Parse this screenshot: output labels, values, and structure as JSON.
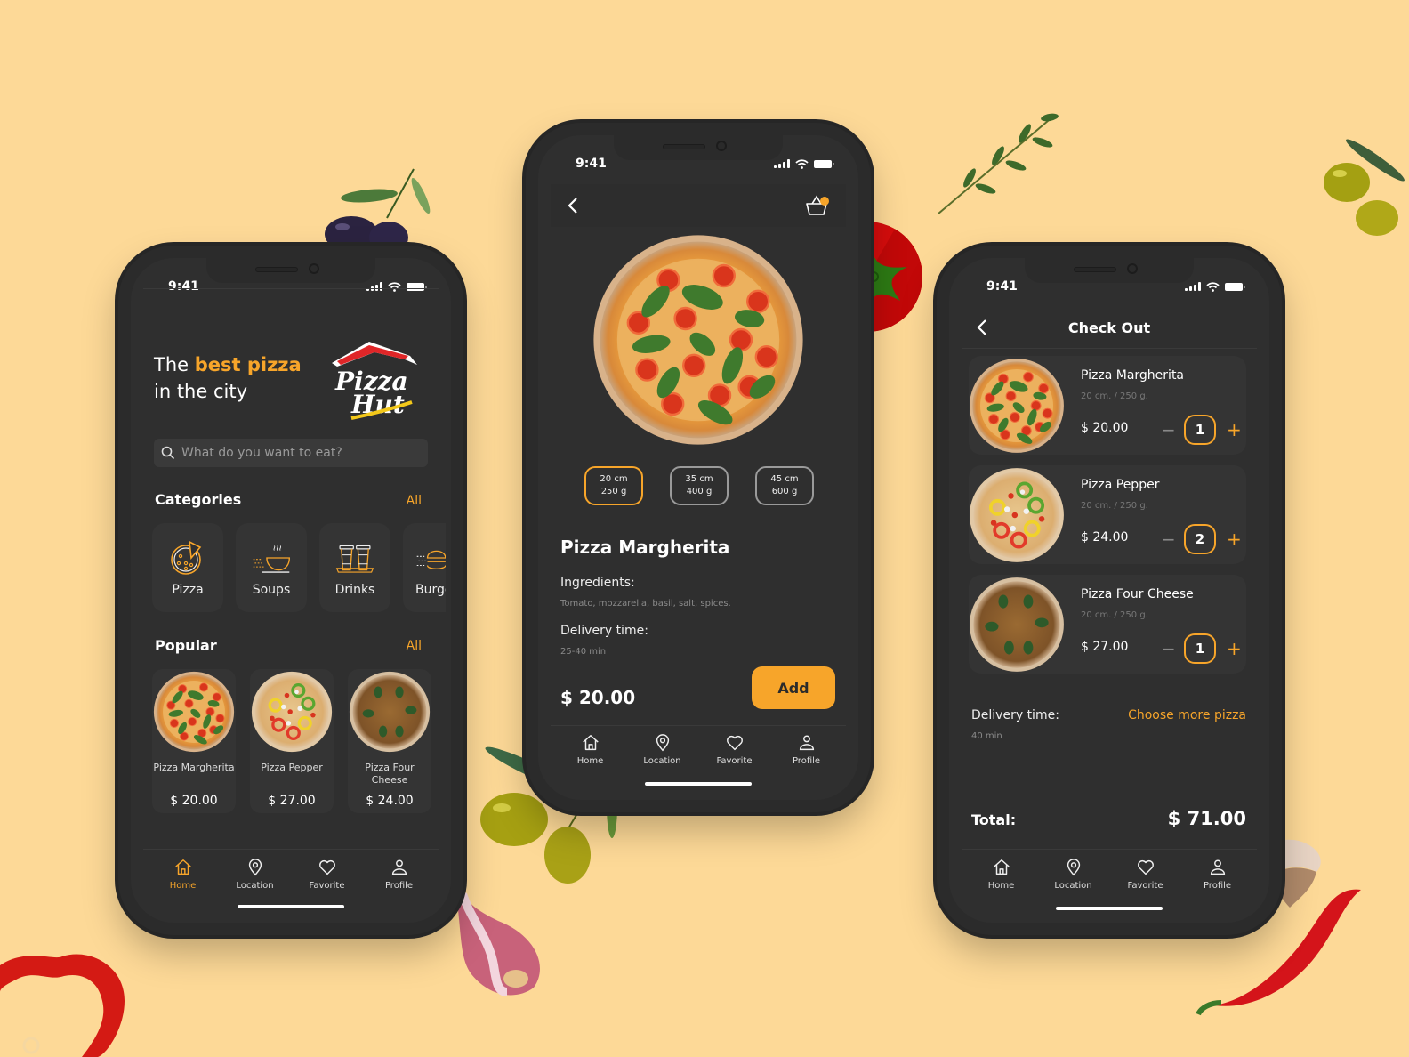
{
  "theme": {
    "background": "#fdd997",
    "accent": "#f7a52a",
    "phone_bg": "#2f2f2f"
  },
  "status_bar": {
    "time": "9:41"
  },
  "home_screen": {
    "headline_part1": "The ",
    "headline_highlight": "best pizza",
    "headline_part2": "in the city",
    "brand_logo": "Pizza Hut",
    "search": {
      "placeholder": "What do you want to eat?",
      "value": ""
    },
    "categories": {
      "title": "Categories",
      "all_label": "All",
      "items": [
        {
          "label": "Pizza",
          "icon": "pizza-icon"
        },
        {
          "label": "Soups",
          "icon": "soup-bowl-icon"
        },
        {
          "label": "Drinks",
          "icon": "drink-cups-icon"
        },
        {
          "label": "Burgers",
          "icon": "burger-icon"
        }
      ]
    },
    "popular": {
      "title": "Popular",
      "all_label": "All",
      "items": [
        {
          "name": "Pizza Margherita",
          "price": "$ 20.00"
        },
        {
          "name": "Pizza Pepper",
          "price": "$ 27.00"
        },
        {
          "name": "Pizza Four Cheese",
          "price": "$ 24.00"
        }
      ]
    },
    "active_tab": "Home"
  },
  "detail_screen": {
    "cart_badge": true,
    "sizes": [
      {
        "size": "20 cm",
        "weight": "250 g",
        "selected": true
      },
      {
        "size": "35 cm",
        "weight": "400 g",
        "selected": false
      },
      {
        "size": "45 cm",
        "weight": "600 g",
        "selected": false
      }
    ],
    "title": "Pizza Margherita",
    "ingredients_label": "Ingredients:",
    "ingredients": "Tomato, mozzarella, basil, salt, spices.",
    "delivery_label": "Delivery time:",
    "delivery_time": "25-40 min",
    "price": "$ 20.00",
    "add_label": "Add"
  },
  "checkout_screen": {
    "title": "Check Out",
    "items": [
      {
        "name": "Pizza Margherita",
        "details": "20 cm. / 250 g.",
        "price": "$ 20.00",
        "qty": "1"
      },
      {
        "name": "Pizza Pepper",
        "details": "20 cm. / 250 g.",
        "price": "$ 24.00",
        "qty": "2"
      },
      {
        "name": "Pizza Four Cheese",
        "details": "20 cm. / 250 g.",
        "price": "$ 27.00",
        "qty": "1"
      }
    ],
    "delivery_label": "Delivery time:",
    "delivery_time": "40 min",
    "choose_more": "Choose more pizza",
    "total_label": "Total:",
    "total_value": "$ 71.00"
  },
  "tabbar": {
    "tabs": [
      {
        "label": "Home",
        "icon": "home-icon"
      },
      {
        "label": "Location",
        "icon": "location-pin-icon"
      },
      {
        "label": "Favorite",
        "icon": "heart-icon"
      },
      {
        "label": "Profile",
        "icon": "profile-icon"
      }
    ]
  }
}
